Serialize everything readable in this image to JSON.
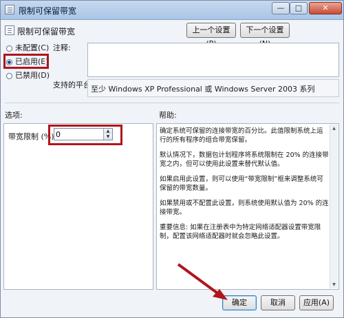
{
  "window": {
    "title": "限制可保留带宽",
    "min_glyph": "—",
    "max_glyph": "□",
    "close_glyph": "✕"
  },
  "header": {
    "policy_name": "限制可保留带宽",
    "prev_label": "上一个设置(P)",
    "next_label": "下一个设置(N)"
  },
  "state": {
    "options": [
      {
        "label": "未配置(C)",
        "checked": false
      },
      {
        "label": "已启用(E)",
        "checked": true
      },
      {
        "label": "已禁用(D)",
        "checked": false
      }
    ]
  },
  "comment": {
    "label": "注释:",
    "value": ""
  },
  "platform": {
    "label": "支持的平台:",
    "value": "至少 Windows XP Professional 或 Windows Server 2003 系列"
  },
  "options_section": {
    "title": "选项:",
    "bandwidth_label": "带宽限制 (%):",
    "bandwidth_value": "0",
    "up_glyph": "▲",
    "down_glyph": "▼"
  },
  "help_section": {
    "title": "帮助:",
    "paragraphs": [
      "确定系统可保留的连接带宽的百分比。此值限制系统上运行的所有程序的组合带宽保留。",
      "默认情况下，数据包计划程序将系统限制在 20% 的连接带宽之内，但可以使用此设置来替代默认值。",
      "如果启用此设置，则可以使用“带宽限制”框来调整系统可保留的带宽数量。",
      "如果禁用或不配置此设置，则系统使用默认值为 20% 的连接带宽。",
      "重要信息: 如果在注册表中为特定网络适配器设置带宽限制，配置该网络适配器时就会忽略此设置。"
    ],
    "up_glyph": "▲",
    "down_glyph": "▼"
  },
  "footer": {
    "ok_label": "确定",
    "cancel_label": "取消",
    "apply_label": "应用(A)"
  },
  "colors": {
    "highlight": "#b0151b",
    "arrow": "#b0151b"
  }
}
